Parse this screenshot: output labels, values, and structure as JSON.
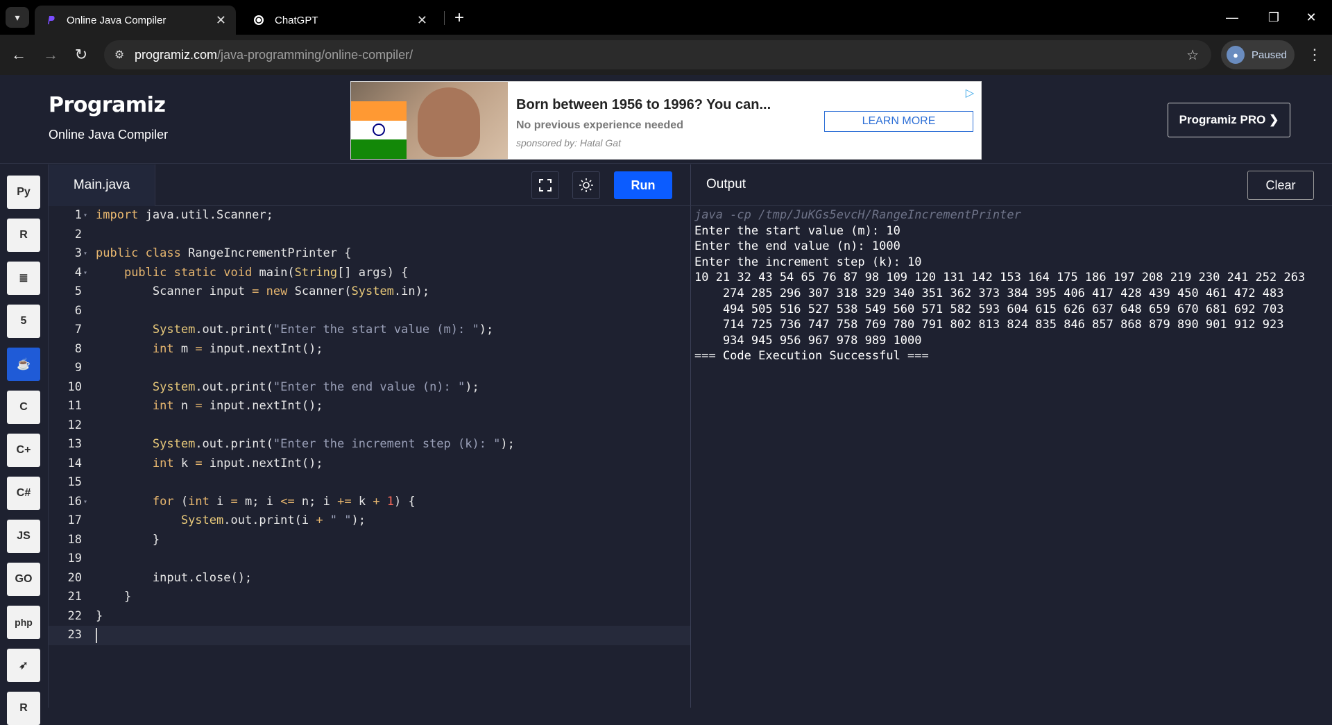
{
  "browser": {
    "tabs": [
      {
        "title": "Online Java Compiler",
        "active": true
      },
      {
        "title": "ChatGPT",
        "active": false
      }
    ],
    "url_host": "programiz.com",
    "url_path": "/java-programming/online-compiler/",
    "profile_label": "Paused"
  },
  "header": {
    "logo": "Programiz",
    "subtitle": "Online Java Compiler",
    "pro_button": "Programiz PRO ❯"
  },
  "ad": {
    "title": "Born between 1956 to 1996? You can...",
    "description": "No previous experience needed",
    "sponsor": "sponsored by: Hatal Gat",
    "button": "LEARN MORE"
  },
  "languages": [
    {
      "name": "python-icon",
      "glyph": "Py",
      "active": false
    },
    {
      "name": "r-icon",
      "glyph": "R",
      "active": false
    },
    {
      "name": "sql-icon",
      "glyph": "≣",
      "active": false
    },
    {
      "name": "html-icon",
      "glyph": "5",
      "active": false
    },
    {
      "name": "java-icon",
      "glyph": "☕",
      "active": true
    },
    {
      "name": "c-icon",
      "glyph": "C",
      "active": false
    },
    {
      "name": "cpp-icon",
      "glyph": "C+",
      "active": false
    },
    {
      "name": "csharp-icon",
      "glyph": "C#",
      "active": false
    },
    {
      "name": "javascript-icon",
      "glyph": "JS",
      "active": false
    },
    {
      "name": "go-icon",
      "glyph": "GO",
      "active": false
    },
    {
      "name": "php-icon",
      "glyph": "php",
      "active": false
    },
    {
      "name": "swift-icon",
      "glyph": "➶",
      "active": false
    },
    {
      "name": "rust-icon",
      "glyph": "R",
      "active": false
    }
  ],
  "editor": {
    "file_name": "Main.java",
    "run_label": "Run",
    "lines": [
      "import java.util.Scanner;",
      "",
      "public class RangeIncrementPrinter {",
      "    public static void main(String[] args) {",
      "        Scanner input = new Scanner(System.in);",
      "",
      "        System.out.print(\"Enter the start value (m): \");",
      "        int m = input.nextInt();",
      "",
      "        System.out.print(\"Enter the end value (n): \");",
      "        int n = input.nextInt();",
      "",
      "        System.out.print(\"Enter the increment step (k): \");",
      "        int k = input.nextInt();",
      "",
      "        for (int i = m; i <= n; i += k + 1) {",
      "            System.out.print(i + \" \");",
      "        }",
      "",
      "        input.close();",
      "    }",
      "}",
      ""
    ]
  },
  "output": {
    "title": "Output",
    "clear_label": "Clear",
    "command": "java -cp /tmp/JuKGs5evcH/RangeIncrementPrinter",
    "lines": [
      "Enter the start value (m): 10",
      "Enter the end value (n): 1000",
      "Enter the increment step (k): 10",
      "10 21 32 43 54 65 76 87 98 109 120 131 142 153 164 175 186 197 208 219 230 241 252 263",
      "    274 285 296 307 318 329 340 351 362 373 384 395 406 417 428 439 450 461 472 483",
      "    494 505 516 527 538 549 560 571 582 593 604 615 626 637 648 659 670 681 692 703",
      "    714 725 736 747 758 769 780 791 802 813 824 835 846 857 868 879 890 901 912 923",
      "    934 945 956 967 978 989 1000",
      "=== Code Execution Successful ==="
    ]
  }
}
